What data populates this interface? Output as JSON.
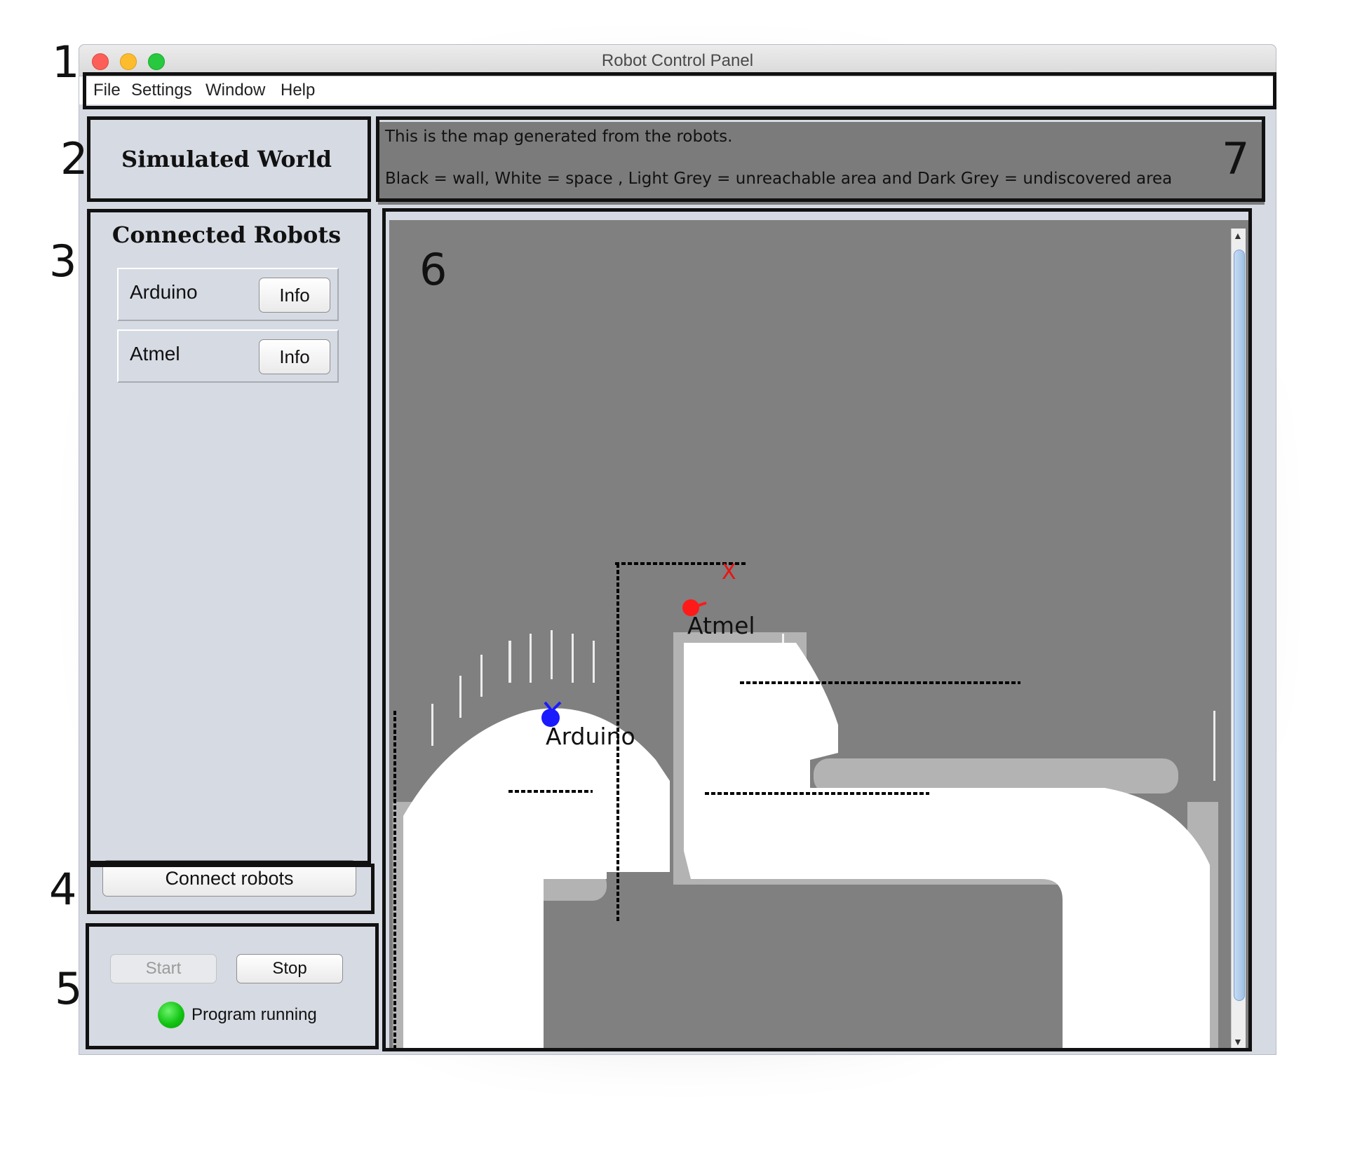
{
  "window": {
    "title": "Robot Control Panel"
  },
  "menu": {
    "items": [
      "File",
      "Settings",
      "Window",
      "Help"
    ]
  },
  "world_panel": {
    "title": "Simulated World"
  },
  "description": {
    "line1": "This is the map generated from the robots.",
    "line2": "Black = wall, White = space , Light Grey = unreachable area and Dark Grey = undiscovered area"
  },
  "robots_panel": {
    "title": "Connected Robots",
    "robots": [
      {
        "name": "Arduino",
        "info_label": "Info",
        "map_color": "#1a1aff"
      },
      {
        "name": "Atmel",
        "info_label": "Info",
        "map_color": "#ff1a1a"
      }
    ],
    "connect_label": "Connect robots"
  },
  "controls": {
    "start_label": "Start",
    "stop_label": "Stop",
    "status_text": "Program running",
    "status_color": "#13c413"
  },
  "map": {
    "target_marker": "X",
    "colors": {
      "wall": "#000000",
      "space": "#ffffff",
      "unreachable": "#b3b3b3",
      "undiscovered": "#808080"
    }
  },
  "annotations": [
    "1",
    "2",
    "3",
    "4",
    "5",
    "6",
    "7"
  ]
}
